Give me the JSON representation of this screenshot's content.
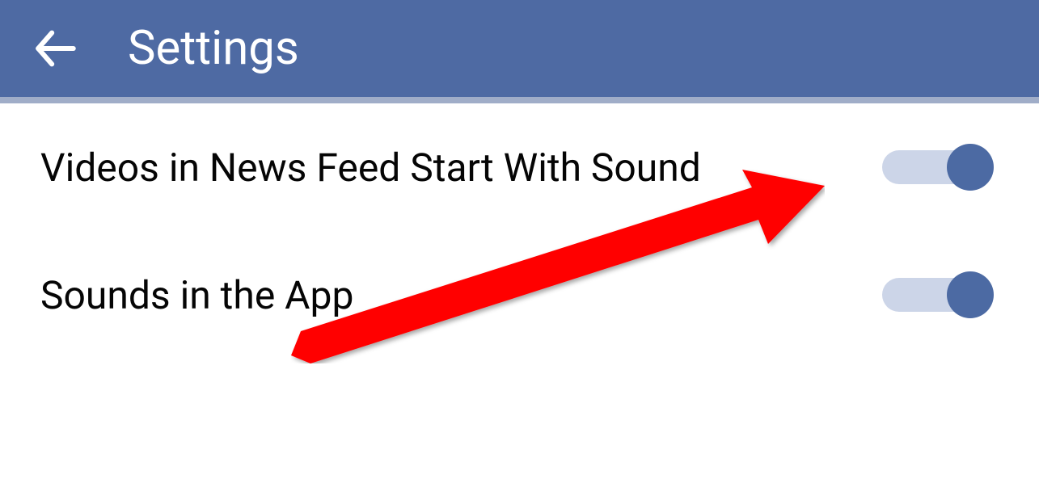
{
  "header": {
    "title": "Settings"
  },
  "settings": {
    "items": [
      {
        "label": "Videos in News Feed Start With Sound",
        "enabled": true
      },
      {
        "label": "Sounds in the App",
        "enabled": true
      }
    ]
  },
  "colors": {
    "brand": "#4e6aa3",
    "toggle_track": "#ccd5e8",
    "annotation_arrow": "#ff0000"
  }
}
